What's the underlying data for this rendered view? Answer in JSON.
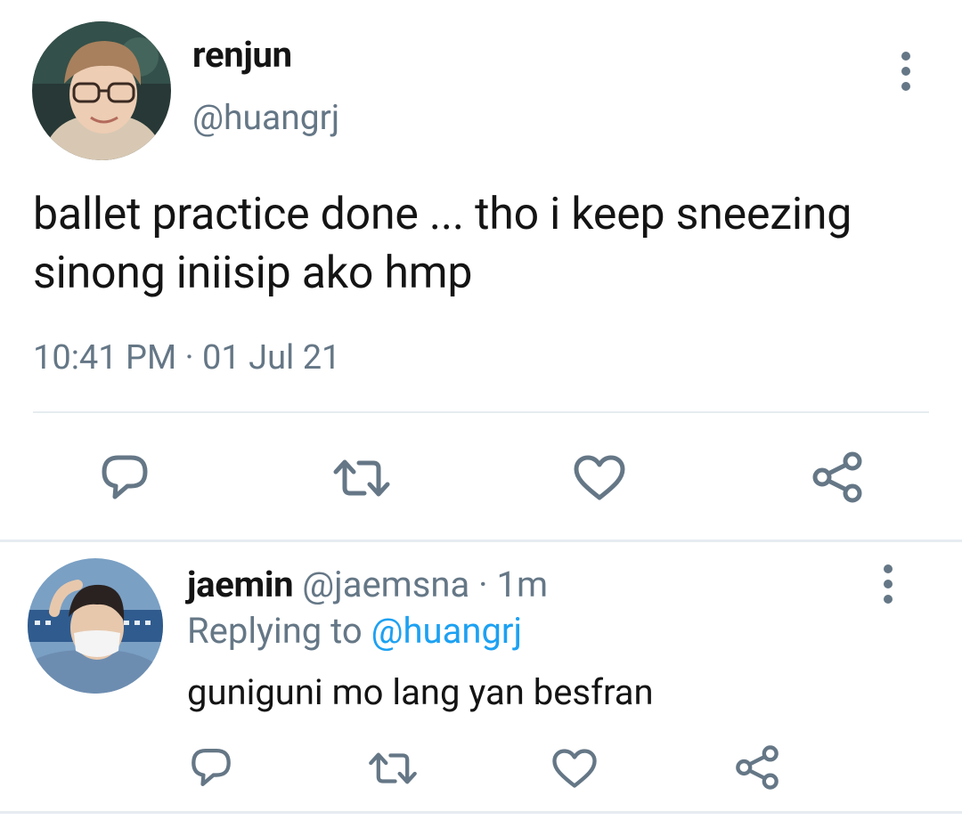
{
  "main_tweet": {
    "author_name": "renjun",
    "author_handle": "@huangrj",
    "text": "ballet practice done ... tho i keep sneezing sinong iniisip ako hmp",
    "timestamp": "10:41 PM · 01 Jul 21",
    "actions": [
      "reply-icon",
      "retweet-icon",
      "like-icon",
      "share-icon"
    ]
  },
  "reply": {
    "author_name": "jaemin",
    "author_handle": "@jaemsna",
    "separator": "·",
    "time": "1m",
    "replying_label": "Replying to",
    "replying_handle": "@huangrj",
    "text": "guniguni mo lang yan besfran",
    "actions": [
      "reply-icon",
      "retweet-icon",
      "like-icon",
      "share-icon"
    ]
  },
  "colors": {
    "text": "#141414",
    "secondary": "#657786",
    "link": "#1da1f2",
    "divider": "#e6ecf0"
  }
}
